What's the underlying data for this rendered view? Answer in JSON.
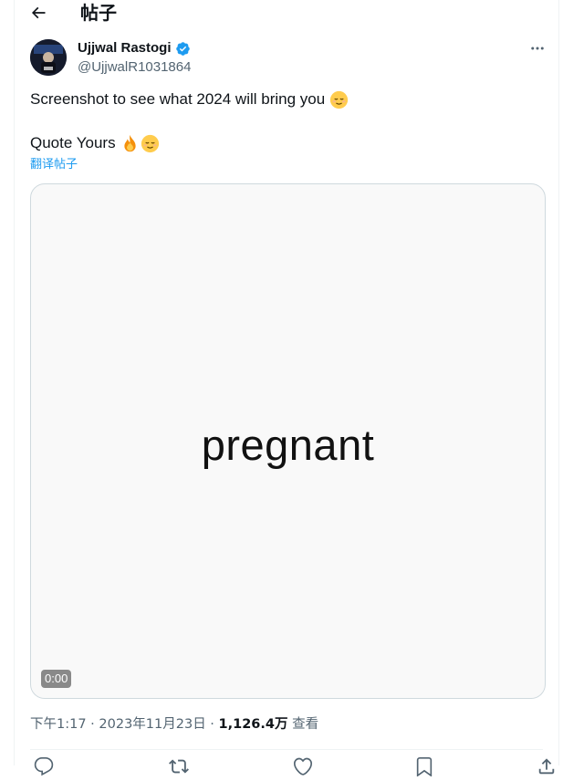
{
  "header": {
    "title": "帖子"
  },
  "author": {
    "name": "Ujjwal Rastogi",
    "handle": "@UjjwalR1031864",
    "verified": true
  },
  "post": {
    "line1": "Screenshot to see what 2024 will bring you",
    "line1_emoji": "relieved-face-emoji",
    "line2": "Quote Yours",
    "line2_emojis": [
      "fire-emoji",
      "relieved-face-emoji"
    ],
    "translate_label": "翻译帖子"
  },
  "media": {
    "word": "pregnant",
    "video_time": "0:00"
  },
  "meta": {
    "time": "下午1:17",
    "sep1": " · ",
    "date": "2023年11月23日",
    "sep2": " · ",
    "views": "1,126.4万",
    "views_label": " 查看"
  },
  "colors": {
    "accent": "#1d9bf0",
    "secondary_text": "#536471",
    "border": "#cfd9de"
  },
  "icons": {
    "back": "arrow-left-icon",
    "more": "more-horizontal-icon",
    "verified": "verified-badge-icon",
    "reply": "reply-icon",
    "repost": "repost-icon",
    "like": "heart-icon",
    "bookmark": "bookmark-icon",
    "share": "share-icon"
  }
}
